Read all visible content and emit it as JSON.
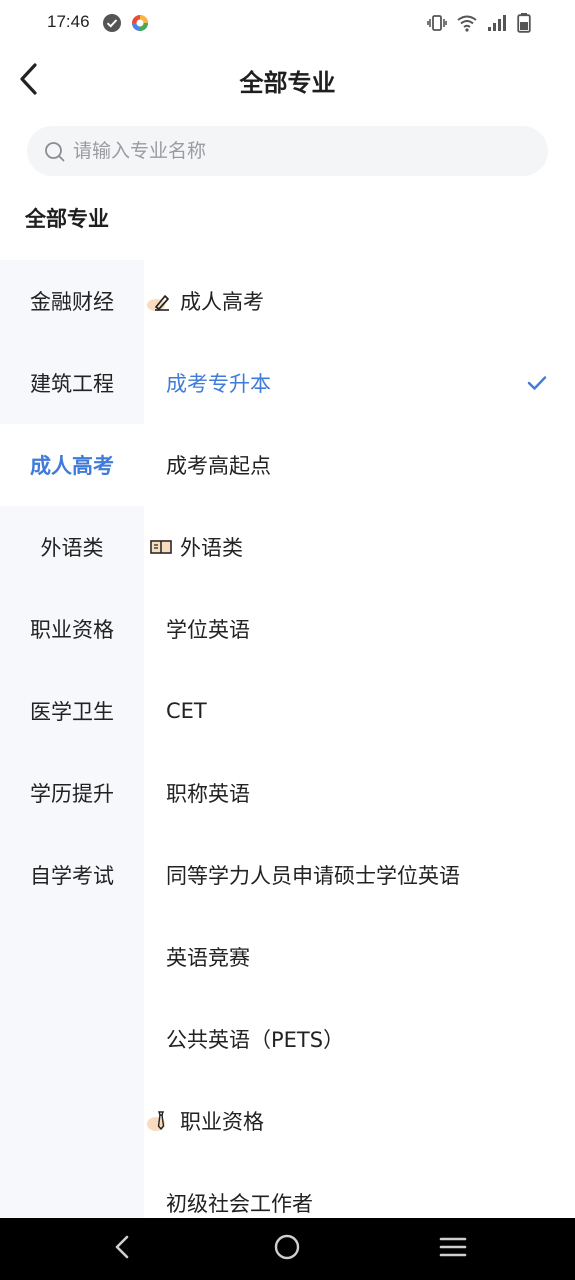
{
  "status_bar": {
    "time": "17:46",
    "left_icons": [
      "check-circle-icon",
      "app-logo-icon"
    ],
    "right_icons": [
      "vibrate-icon",
      "wifi-icon",
      "signal-icon",
      "battery-icon"
    ]
  },
  "header": {
    "title": "全部专业",
    "back_icon": "chevron-left-icon"
  },
  "search": {
    "placeholder": "请输入专业名称",
    "value": ""
  },
  "section_title": "全部专业",
  "sidebar": {
    "items": [
      {
        "label": "金融财经",
        "active": false
      },
      {
        "label": "建筑工程",
        "active": false
      },
      {
        "label": "成人高考",
        "active": true
      },
      {
        "label": "外语类",
        "active": false
      },
      {
        "label": "职业资格",
        "active": false
      },
      {
        "label": "医学卫生",
        "active": false
      },
      {
        "label": "学历提升",
        "active": false
      },
      {
        "label": "自学考试",
        "active": false
      }
    ]
  },
  "content": {
    "rows": [
      {
        "type": "group",
        "label": "成人高考",
        "icon": "pen-icon"
      },
      {
        "type": "item",
        "label": "成考专升本",
        "selected": true
      },
      {
        "type": "item",
        "label": "成考高起点",
        "selected": false
      },
      {
        "type": "group",
        "label": "外语类",
        "icon": "book-icon"
      },
      {
        "type": "item",
        "label": "学位英语",
        "selected": false
      },
      {
        "type": "item",
        "label": "CET",
        "selected": false
      },
      {
        "type": "item",
        "label": "职称英语",
        "selected": false
      },
      {
        "type": "item",
        "label": "同等学力人员申请硕士学位英语",
        "selected": false
      },
      {
        "type": "item",
        "label": "英语竞赛",
        "selected": false
      },
      {
        "type": "item",
        "label": "公共英语（PETS）",
        "selected": false
      },
      {
        "type": "group",
        "label": "职业资格",
        "icon": "tie-icon"
      },
      {
        "type": "item",
        "label": "初级社会工作者",
        "selected": false
      }
    ]
  },
  "colors": {
    "accent": "#3f7bd9",
    "sidebar_bg": "#f6f8fb",
    "search_bg": "#f4f5f7",
    "nav_bar": "#000000"
  },
  "nav_bar": {
    "icons": [
      "back-triangle-icon",
      "home-circle-icon",
      "menu-lines-icon"
    ]
  }
}
